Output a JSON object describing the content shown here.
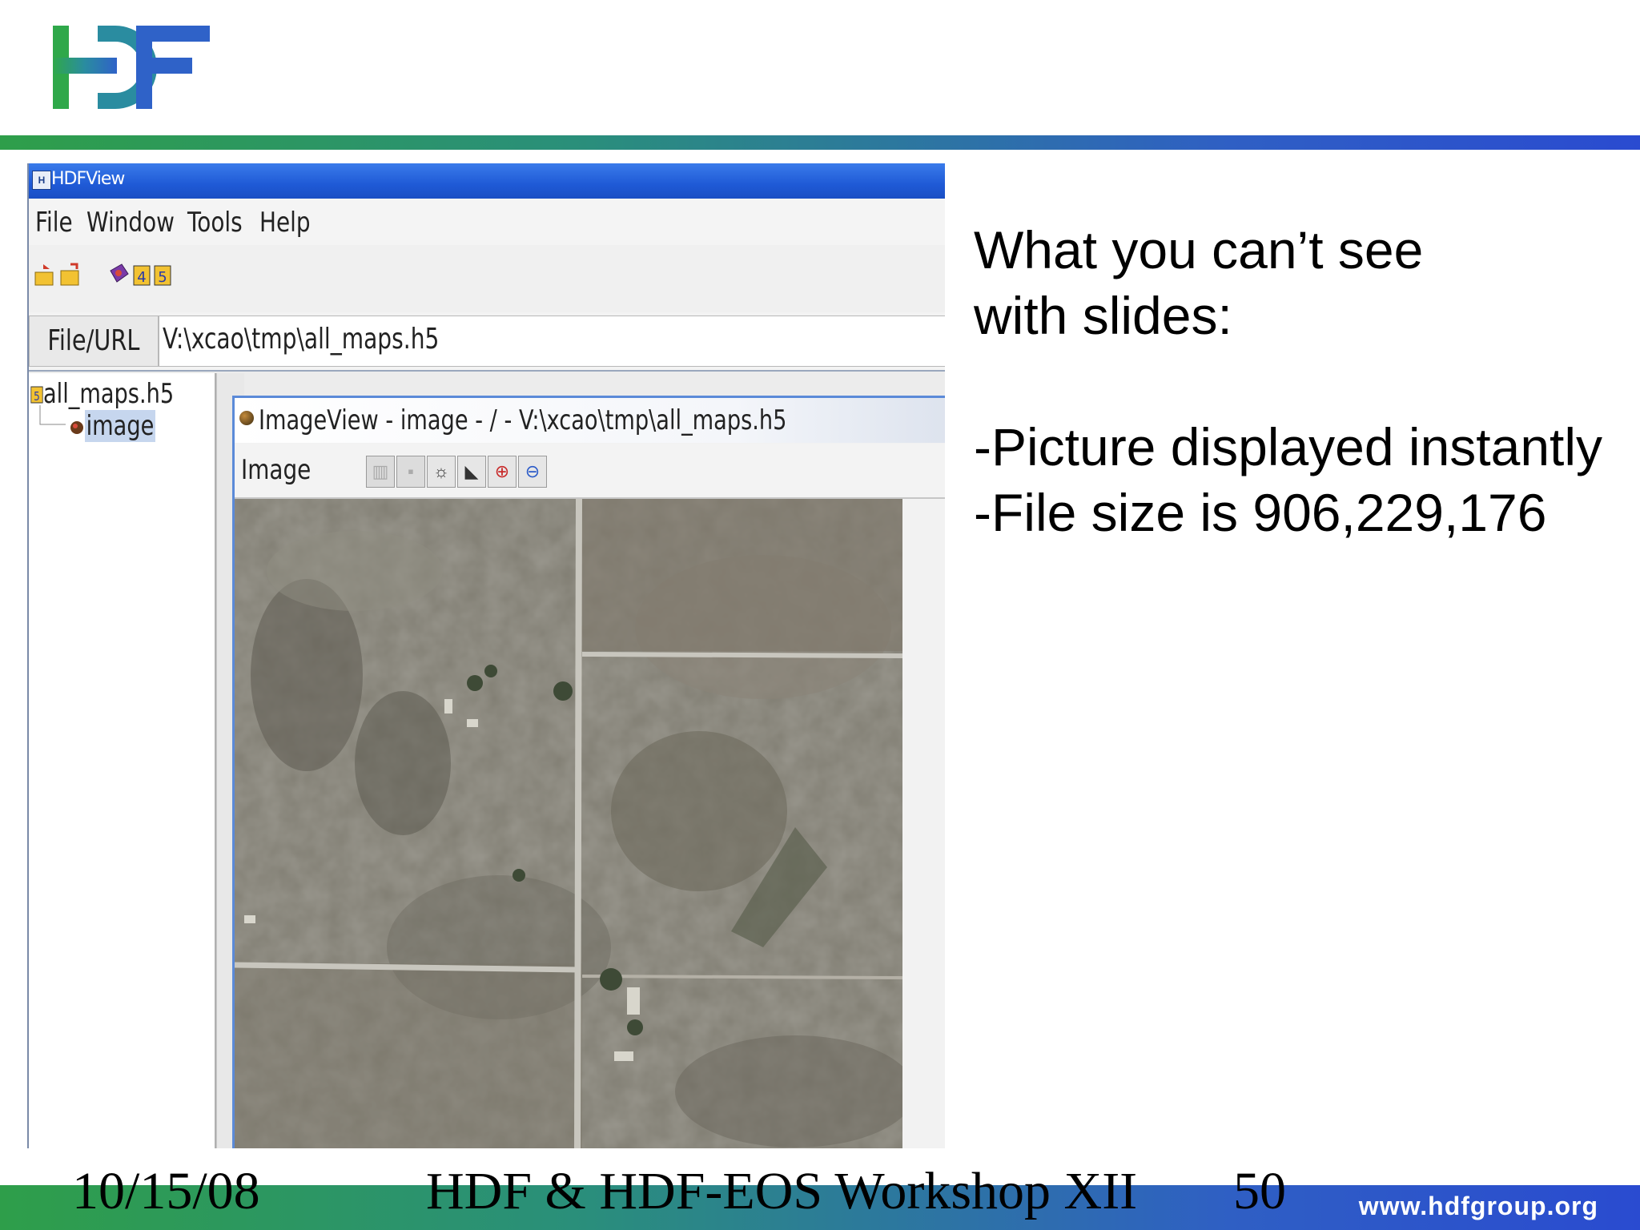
{
  "slide": {
    "footer_date": "10/15/08",
    "footer_title": "HDF & HDF-EOS  Workshop XII",
    "footer_page": "50",
    "footer_url": "www.hdfgroup.org",
    "heading_line1": "What you can’t see",
    "heading_line2": "with slides:",
    "bullet1": "-Picture displayed instantly",
    "bullet2": "-File size is 906,229,176",
    "colors": {
      "brand_green": "#2e9e4a",
      "brand_blue": "#2f5fc4"
    }
  },
  "hdfview": {
    "window_title": "HDFView",
    "menu": [
      "File",
      "Window",
      "Tools",
      "Help"
    ],
    "toolbar_icons": [
      "open-file-icon",
      "close-file-icon",
      "help-book-icon",
      "hdf4-icon",
      "hdf5-icon"
    ],
    "url_label": "File/URL",
    "url_value": "V:\\xcao\\tmp\\all_maps.h5",
    "tree_root": "all_maps.h5",
    "tree_child": "image",
    "imageview": {
      "title": "ImageView  -  image  -  /  -  V:\\xcao\\tmp\\all_maps.h5",
      "menu": "Image",
      "toolbar_icons": [
        "histogram-icon",
        "palette-icon",
        "brightness-icon",
        "contour-icon",
        "zoom-in-icon",
        "zoom-out-icon"
      ]
    }
  }
}
